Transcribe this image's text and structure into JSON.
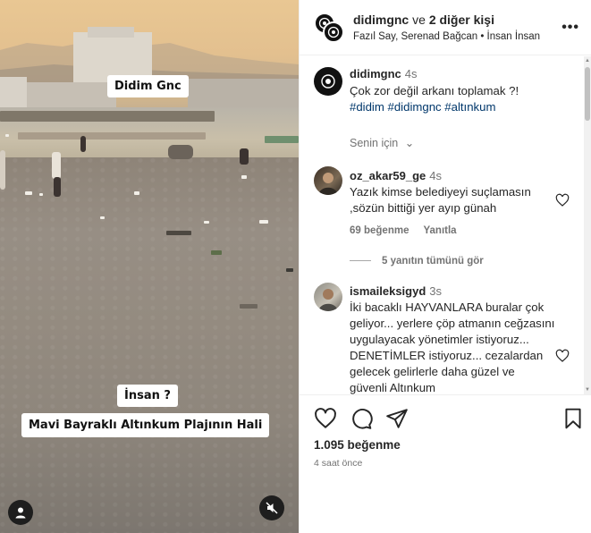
{
  "media": {
    "label_top": "Didim Gnc",
    "label_question": "İnsan ?",
    "label_caption": "Mavi Bayraklı Altınkum Plajının Hali",
    "icons": {
      "account": "user-circle-icon",
      "mute": "speaker-muted-icon"
    }
  },
  "header": {
    "username": "didimgnc",
    "connector": "ve",
    "others": "2 diğer kişi",
    "subtitle": "Fazıl Say, Serenad Bağcan • İnsan İnsan",
    "more_label": "•••"
  },
  "caption": {
    "username": "didimgnc",
    "time": "4s",
    "text": "Çok zor değil arkanı toplamak ?!",
    "tags": "#didim #didimgnc #altınkum",
    "translation_label": "Senin için",
    "chevron": "⌄"
  },
  "comments": [
    {
      "username": "oz_akar59_ge",
      "time": "4s",
      "text": "Yazık kimse belediyeyi suçlamasın ,sözün bittiği yer ayıp günah",
      "likes": "69 beğenme",
      "reply": "Yanıtla"
    },
    {
      "replies_label": "5 yanıtın tümünü gör"
    },
    {
      "username": "ismaileksigyd",
      "time": "3s",
      "text": "İki bacaklı HAYVANLARA buralar çok geliyor... yerlere çöp atmanın ceğzasını uygulayacak yönetimler istiyoruz... DENETİMLER istiyoruz... cezalardan gelecek gelirlerle daha güzel ve güvenli Altınkum"
    }
  ],
  "footer": {
    "likes": "1.095 beğenme",
    "time_ago": "4 saat önce"
  },
  "colors": {
    "link": "#00376b",
    "muted": "#737373",
    "text": "#262626"
  }
}
